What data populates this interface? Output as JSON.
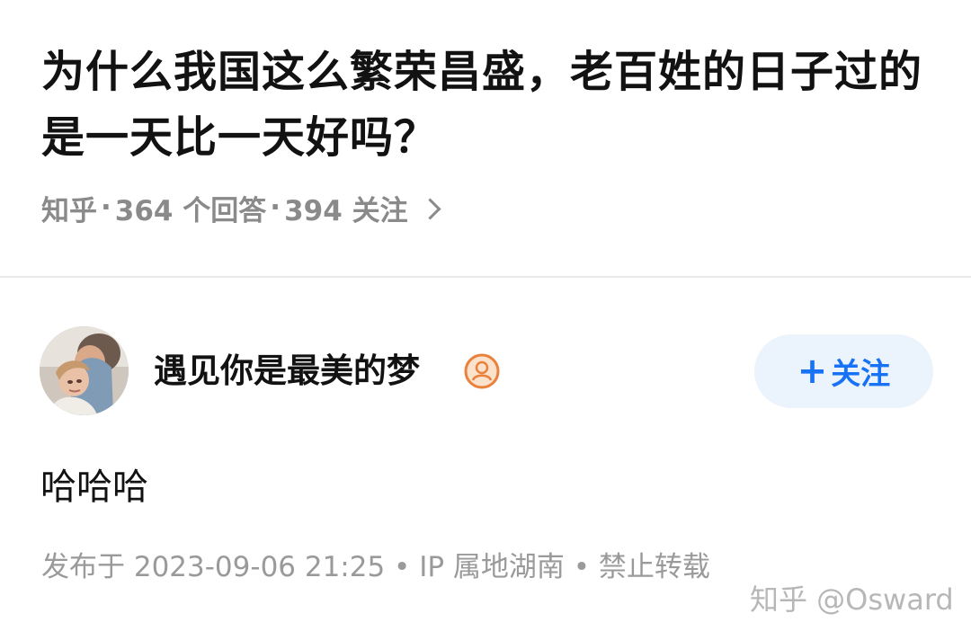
{
  "question": {
    "title": "为什么我国这么繁荣昌盛，老百姓的日子过的是一天比一天好吗？",
    "source": "知乎",
    "separator": "·",
    "answers_count": "364 个回答",
    "followers_count": "394 关注"
  },
  "author": {
    "name": "遇见你是最美的梦",
    "badge_icon": "user-badge-icon",
    "follow_label": "关注",
    "follow_icon": "plus-icon",
    "follow_color": "#1772f6",
    "follow_bg": "#ebf3fc"
  },
  "answer": {
    "content": "哈哈哈",
    "meta": "发布于 2023-09-06 21:25 • IP 属地湖南 • 禁止转载"
  },
  "watermark": {
    "text": "知乎 @Osward"
  }
}
